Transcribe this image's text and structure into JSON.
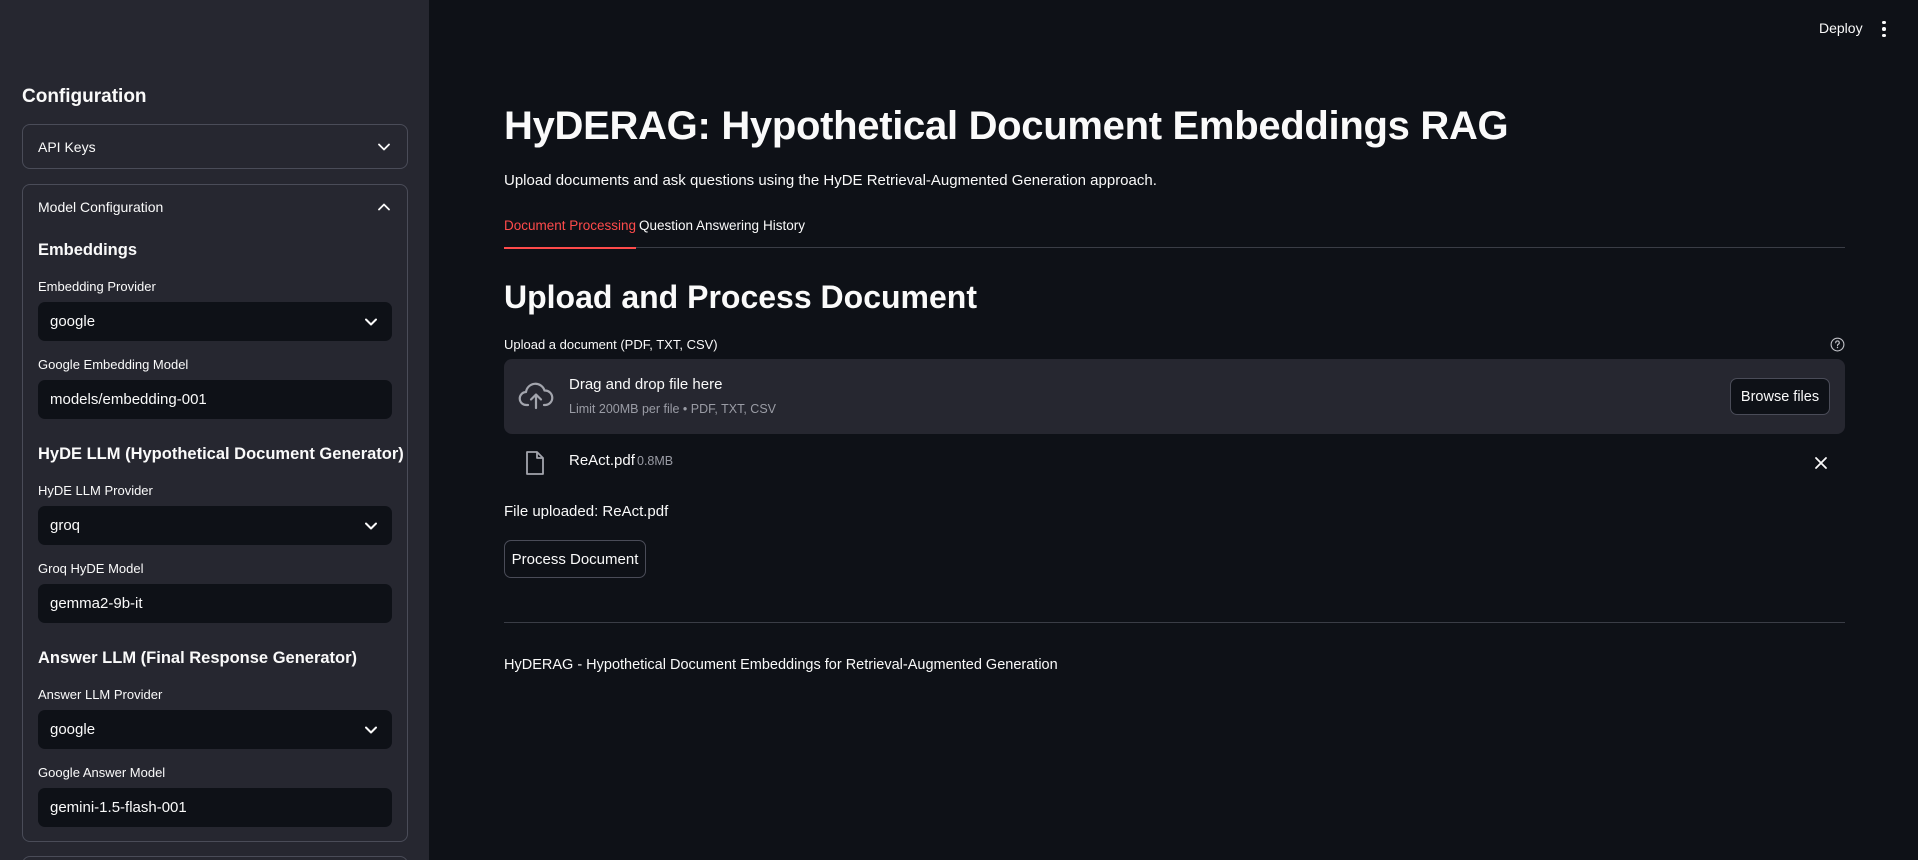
{
  "sidebar": {
    "title": "Configuration",
    "api_keys": {
      "label": "API Keys",
      "expanded": false
    },
    "model_config": {
      "label": "Model Configuration",
      "expanded": true,
      "embeddings": {
        "heading": "Embeddings",
        "provider_label": "Embedding Provider",
        "provider_value": "google",
        "model_label": "Google Embedding Model",
        "model_value": "models/embedding-001"
      },
      "hyde": {
        "heading": "HyDE LLM (Hypothetical Document Generator)",
        "provider_label": "HyDE LLM Provider",
        "provider_value": "groq",
        "model_label": "Groq HyDE Model",
        "model_value": "gemma2-9b-it"
      },
      "answer": {
        "heading": "Answer LLM (Final Response Generator)",
        "provider_label": "Answer LLM Provider",
        "provider_value": "google",
        "model_label": "Google Answer Model",
        "model_value": "gemini-1.5-flash-001"
      }
    }
  },
  "topbar": {
    "deploy_label": "Deploy",
    "menu_icon": "vertical-ellipsis-icon"
  },
  "main": {
    "title": "HyDERAG: Hypothetical Document Embeddings RAG",
    "subtitle": "Upload documents and ask questions using the HyDE Retrieval-Augmented Generation approach.",
    "tabs": [
      {
        "label": "Document Processing",
        "active": true
      },
      {
        "label": "Question Answering",
        "active": false
      },
      {
        "label": "History",
        "active": false
      }
    ],
    "section_title": "Upload and Process Document",
    "uploader": {
      "label": "Upload a document (PDF, TXT, CSV)",
      "drop_text": "Drag and drop file here",
      "limit_text": "Limit 200MB per file • PDF, TXT, CSV",
      "browse_label": "Browse files"
    },
    "file": {
      "name": "ReAct.pdf",
      "size": "0.8MB"
    },
    "uploaded_message": "File uploaded: ReAct.pdf",
    "process_button": "Process Document",
    "footer": "HyDERAG - Hypothetical Document Embeddings for Retrieval-Augmented Generation"
  },
  "colors": {
    "background": "#0e1117",
    "sidebar": "#262730",
    "accent": "#ff4b4b",
    "muted_text": "#9a9ca5"
  }
}
